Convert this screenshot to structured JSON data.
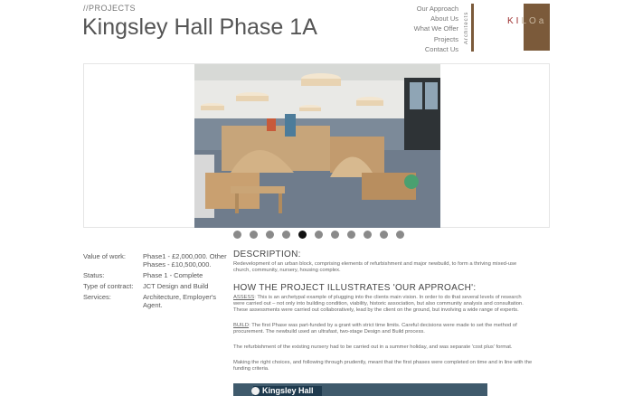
{
  "header": {
    "breadcrumb": "//PROJECTS",
    "title": "Kingsley Hall Phase 1A"
  },
  "nav": {
    "items": [
      "Our Approach",
      "About Us",
      "What We Offer",
      "Projects",
      "Contact Us"
    ],
    "vertical_label": "Architects"
  },
  "logo": {
    "text_dark": "KI",
    "text_light": "LOa"
  },
  "gallery": {
    "dot_count": 11,
    "active_index": 4
  },
  "specs": [
    {
      "label": "Value of work:",
      "value": "Phase1 - £2,000,000. Other Phases - £10,500,000."
    },
    {
      "label": "Status:",
      "value": "Phase 1 - Complete"
    },
    {
      "label": "Type of contract:",
      "value": "JCT Design and Build"
    },
    {
      "label": "Services:",
      "value": "Architecture, Employer's Agent."
    }
  ],
  "content": {
    "description_heading": "DESCRIPTION:",
    "description_text": "Redevelopment of an urban block, comprising elements of refurbishment and major newbuild, to form a thriving mixed-use church, community, nursery, housing complex.",
    "approach_heading": "HOW THE PROJECT ILLUSTRATES 'OUR APPROACH':",
    "assess_lead": "ASSESS",
    "assess_text": ": This is an archetypal example of plugging into the clients main vision. In order to do that several levels of research were carried out – not only into building condition, viability, historic association, but also community analysis and consultation. These assessments were carried out collaboratively, lead by the client on the ground, but involving a wide range of experts.",
    "build_lead": "BUILD",
    "build_text": ": The first Phase was part-funded by a grant with strict time limits. Careful decisions were made to set the method of procurement. The newbuild used an ultrafast, two-stage Design and Build process.",
    "para_nursery": "The refurbishment of the existing nursery had to be carried out in a summer holiday, and was separate 'cost plus' format.",
    "para_choices": "Making the right choices, and following through prudently, meant that the first phases were completed on time and in line with the funding criteria."
  },
  "banner": {
    "label": "Kingsley Hall"
  },
  "colors": {
    "brand_brown": "#7b5a3a",
    "logo_red": "#9b2b2b",
    "active_dot": "#111111"
  }
}
